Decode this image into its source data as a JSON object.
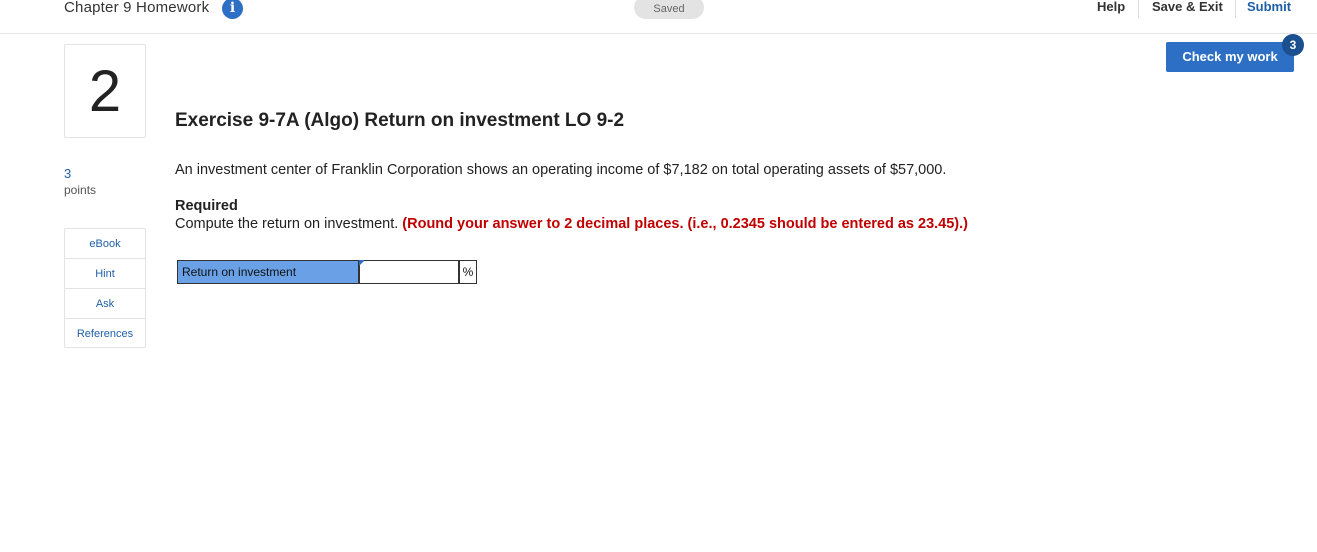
{
  "header": {
    "title": "Chapter 9 Homework",
    "info_glyph": "i",
    "saved_label": "Saved",
    "help_label": "Help",
    "save_exit_label": "Save & Exit",
    "submit_label": "Submit"
  },
  "check_work": {
    "label": "Check my work",
    "remaining_count": "3"
  },
  "question": {
    "number": "2",
    "points_value": "3",
    "points_label": "points",
    "title": "Exercise 9-7A (Algo) Return on investment LO 9-2",
    "problem_text": "An investment center of Franklin Corporation shows an operating income of $7,182 on total operating assets of $57,000.",
    "required_heading": "Required",
    "required_text": "Compute the return on investment.",
    "required_note": "(Round your answer to 2 decimal places. (i.e., 0.2345 should be entered as 23.45).)"
  },
  "resources": {
    "items": [
      {
        "label": "eBook"
      },
      {
        "label": "Hint"
      },
      {
        "label": "Ask"
      },
      {
        "label": "References"
      }
    ]
  },
  "answer": {
    "row_label": "Return on investment",
    "value": "",
    "unit": "%"
  },
  "colors": {
    "accent": "#2d6fc4",
    "label_cell": "#6aa1e6",
    "instruction_red": "#c00000"
  },
  "icons": {
    "info": "info-icon"
  }
}
